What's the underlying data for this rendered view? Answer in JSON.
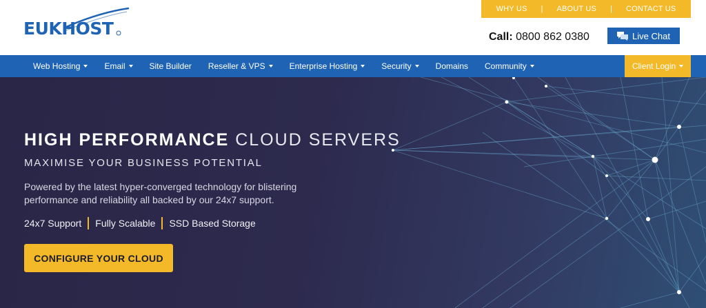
{
  "brand": {
    "logo_text": "EUKHOST",
    "logo_color": "#1e63b4"
  },
  "top_links": [
    "WHY US",
    "ABOUT US",
    "CONTACT US"
  ],
  "contact": {
    "call_label": "Call:",
    "phone": "0800 862 0380",
    "live_chat_label": "Live Chat",
    "live_chat_icon": "chat-bubbles-icon"
  },
  "nav": {
    "items": [
      {
        "label": "Web Hosting",
        "dropdown": true
      },
      {
        "label": "Email",
        "dropdown": true
      },
      {
        "label": "Site Builder",
        "dropdown": false
      },
      {
        "label": "Reseller & VPS",
        "dropdown": true
      },
      {
        "label": "Enterprise Hosting",
        "dropdown": true
      },
      {
        "label": "Security",
        "dropdown": true
      },
      {
        "label": "Domains",
        "dropdown": false
      },
      {
        "label": "Community",
        "dropdown": true
      }
    ],
    "client_login": "Client Login"
  },
  "hero": {
    "title_strong": "HIGH PERFORMANCE",
    "title_light": "CLOUD SERVERS",
    "subtitle": "MAXIMISE YOUR BUSINESS POTENTIAL",
    "description": "Powered by the latest hyper-converged technology for blistering performance and reliability all backed by our 24x7 support.",
    "features": [
      "24x7 Support",
      "Fully Scalable",
      "SSD Based Storage"
    ],
    "cta_label": "CONFIGURE YOUR CLOUD"
  },
  "colors": {
    "primary_blue": "#1e63b4",
    "accent_yellow": "#f3b928",
    "hero_bg": "#2d2a4e"
  }
}
